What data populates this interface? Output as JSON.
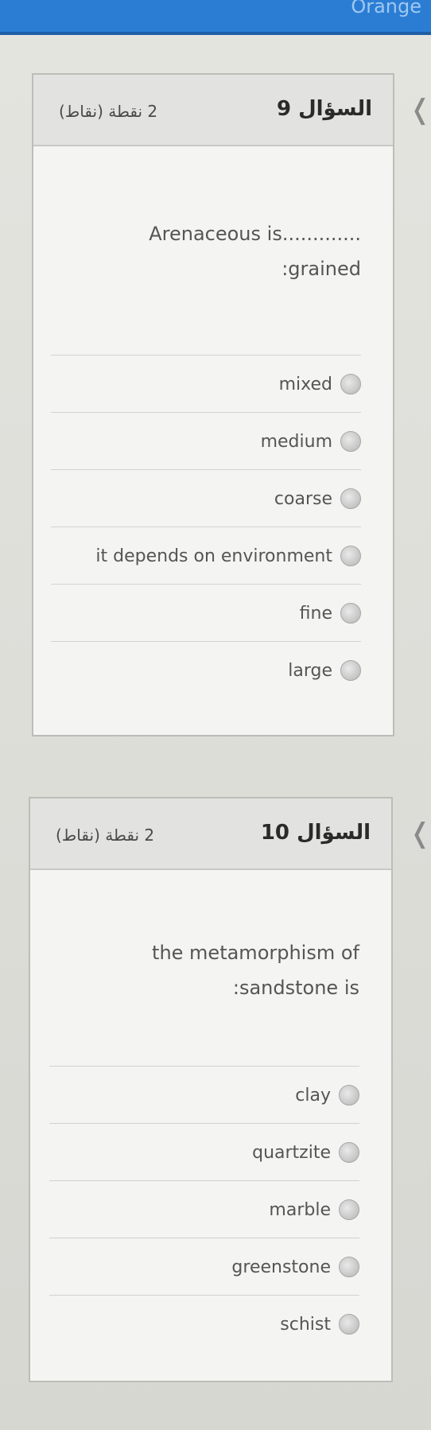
{
  "header": {
    "brand": "Orange"
  },
  "questions": [
    {
      "number_label": "السؤال 9",
      "points_label": "2 نقطة (نقاط)",
      "text_line1": "Arenaceous is.............",
      "text_line2": ":grained",
      "options": [
        "mixed",
        "medium",
        "coarse",
        "it depends on environment",
        "fine",
        "large"
      ]
    },
    {
      "number_label": "السؤال 10",
      "points_label": "2 نقطة (نقاط)",
      "text_line1": "the metamorphism of",
      "text_line2": ":sandstone is",
      "options": [
        "clay",
        "quartzite",
        "marble",
        "greenstone",
        "schist"
      ]
    }
  ],
  "icons": {
    "collapse": "chevron-left-icon",
    "radio": "radio-empty-icon"
  }
}
